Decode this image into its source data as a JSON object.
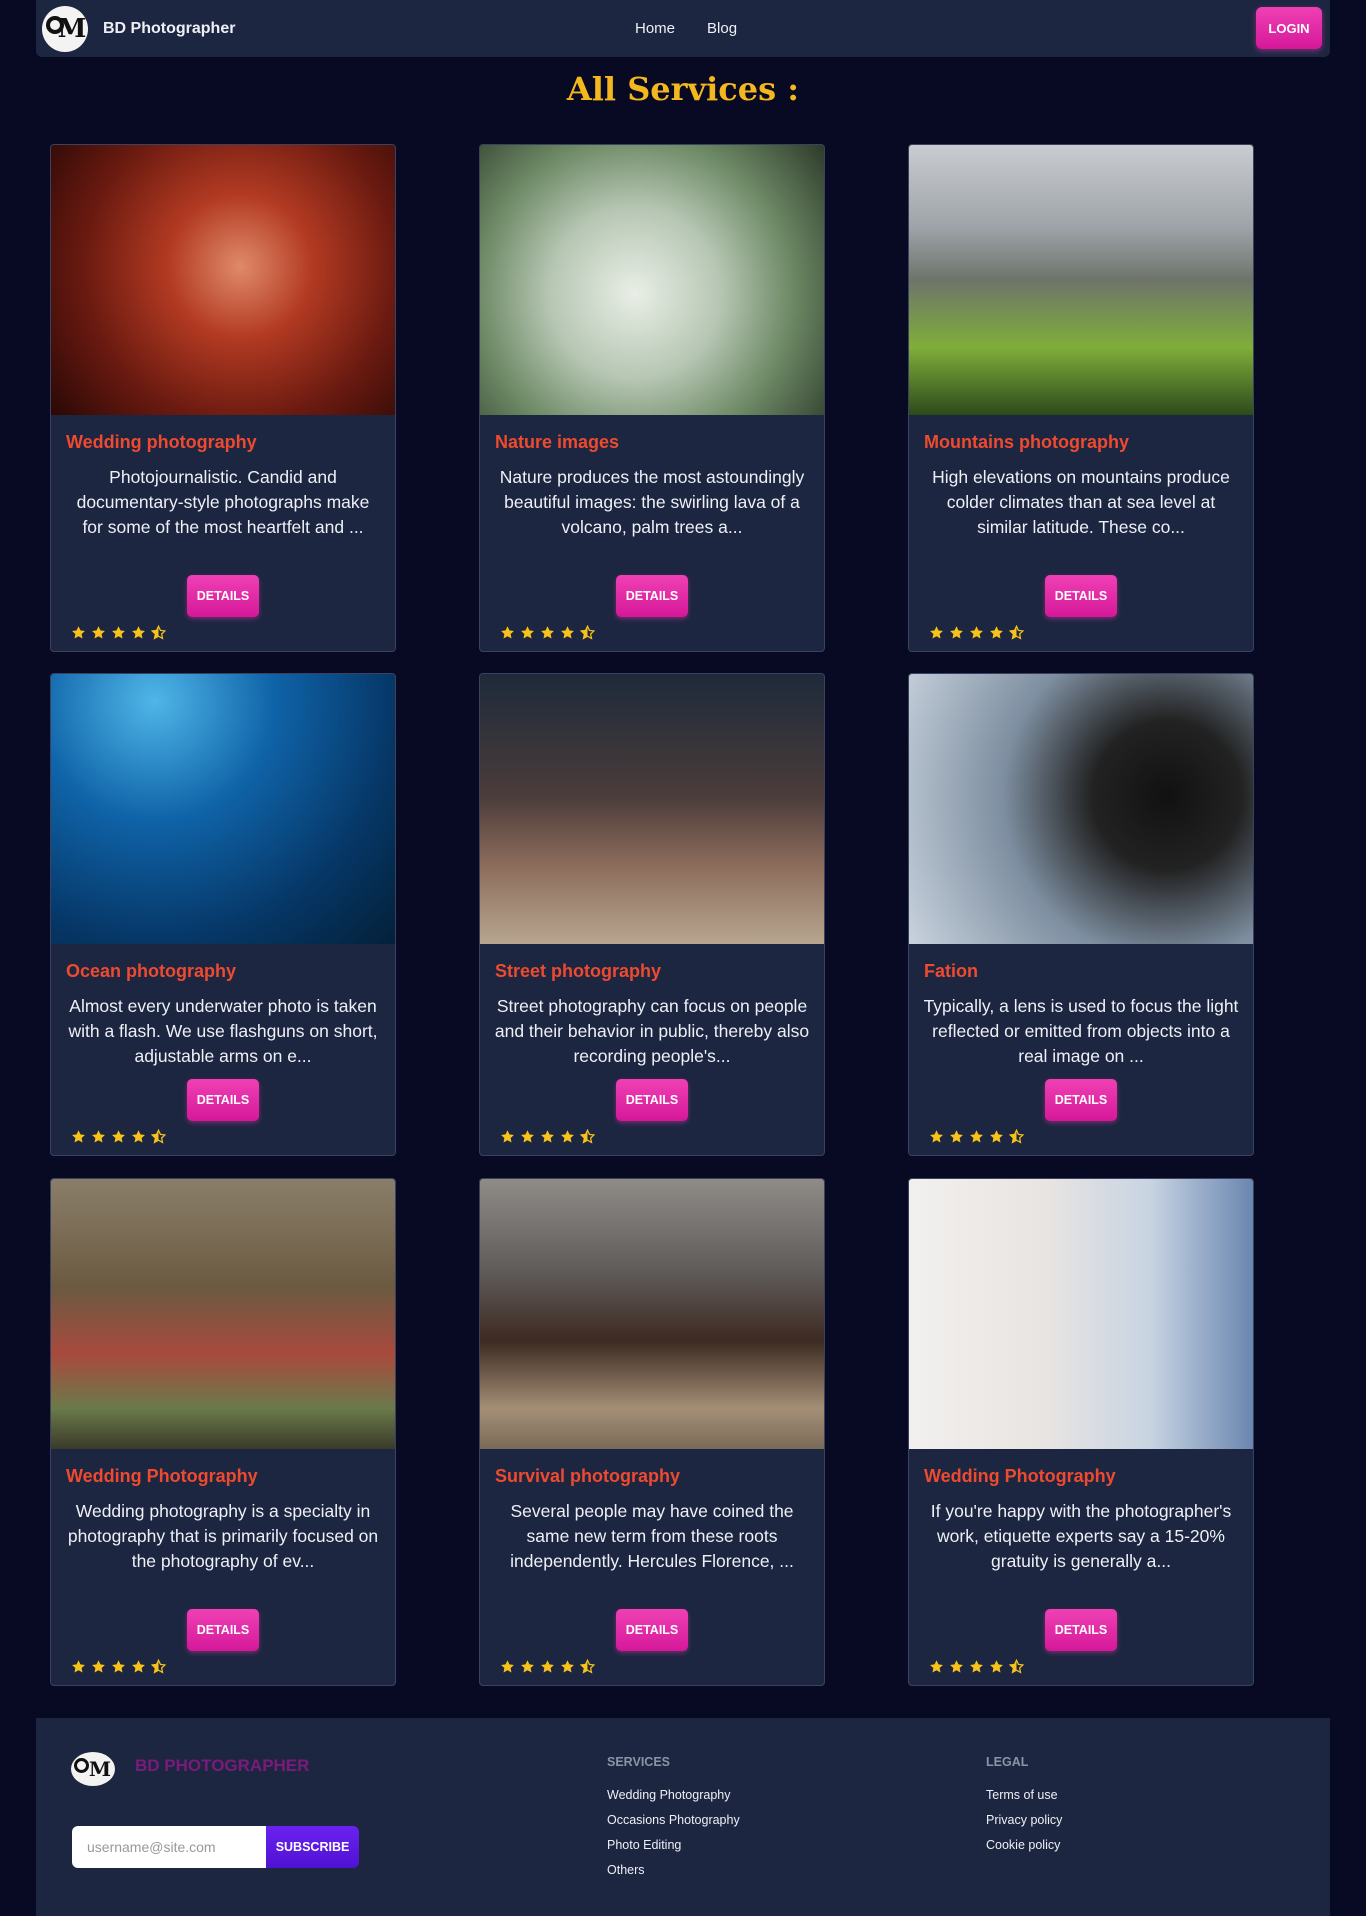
{
  "nav": {
    "brand": "BD Photographer",
    "links": [
      "Home",
      "Blog"
    ],
    "login": "LOGIN"
  },
  "page": {
    "title": "All Services :"
  },
  "cards": [
    {
      "title": "Wedding photography",
      "desc": "Photojournalistic. Candid and documentary-style photographs make for some of the most heartfelt and ...",
      "button": "DETAILS",
      "rating": 4.5
    },
    {
      "title": "Nature images",
      "desc": "Nature produces the most astoundingly beautiful images: the swirling lava of a volcano, palm trees a...",
      "button": "DETAILS",
      "rating": 4.5
    },
    {
      "title": "Mountains photography",
      "desc": "High elevations on mountains produce colder climates than at sea level at similar latitude. These co...",
      "button": "DETAILS",
      "rating": 4.5
    },
    {
      "title": "Ocean photography",
      "desc": "Almost every underwater photo is taken with a flash. We use flashguns on short, adjustable arms on e...",
      "button": "DETAILS",
      "rating": 4.5
    },
    {
      "title": "Street photography",
      "desc": "Street photography can focus on people and their behavior in public, thereby also recording people's...",
      "button": "DETAILS",
      "rating": 4.5
    },
    {
      "title": "Fation",
      "desc": "Typically, a lens is used to focus the light reflected or emitted from objects into a real image on ...",
      "button": "DETAILS",
      "rating": 4.5
    },
    {
      "title": "Wedding Photography",
      "desc": "Wedding photography is a specialty in photography that is primarily focused on the photography of ev...",
      "button": "DETAILS",
      "rating": 4.5
    },
    {
      "title": "Survival photography",
      "desc": "Several people may have coined the same new term from these roots independently. Hercules Florence, ...",
      "button": "DETAILS",
      "rating": 4.5
    },
    {
      "title": "Wedding Photography",
      "desc": "If you're happy with the photographer's work, etiquette experts say a 15-20% gratuity is generally a...",
      "button": "DETAILS",
      "rating": 4.5
    }
  ],
  "footer": {
    "brand": "BD PHOTOGRAPHER",
    "subscribe_placeholder": "username@site.com",
    "subscribe_button": "SUBSCRIBE",
    "services_heading": "SERVICES",
    "services": [
      "Wedding Photography",
      "Occasions Photography",
      "Photo Editing",
      "Others"
    ],
    "legal_heading": "LEGAL",
    "legal": [
      "Terms of use",
      "Privacy policy",
      "Cookie policy"
    ]
  },
  "colors": {
    "accent_pink": "#e02aa6",
    "title_gold": "#f4b81e",
    "card_title_red": "#ee4a30",
    "star_yellow": "#f7c21a",
    "subscribe_purple": "#5d1be0"
  }
}
